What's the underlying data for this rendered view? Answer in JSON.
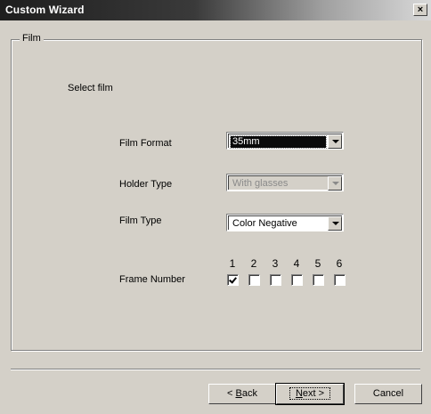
{
  "window": {
    "title": "Custom Wizard",
    "close_label": "×"
  },
  "group": {
    "legend": "Film"
  },
  "main": {
    "heading": "Select film",
    "film_format": {
      "label": "Film Format",
      "value": "35mm"
    },
    "holder_type": {
      "label": "Holder Type",
      "value": "With glasses"
    },
    "film_type": {
      "label": "Film Type",
      "value": "Color Negative"
    },
    "frame_number": {
      "label": "Frame Number",
      "numbers": [
        "1",
        "2",
        "3",
        "4",
        "5",
        "6"
      ],
      "checked": [
        true,
        false,
        false,
        false,
        false,
        false
      ]
    }
  },
  "buttons": {
    "back": {
      "prefix": "< ",
      "mnemonic": "B",
      "rest": "ack"
    },
    "next": {
      "mnemonic": "N",
      "rest": "ext >"
    },
    "cancel": "Cancel"
  }
}
